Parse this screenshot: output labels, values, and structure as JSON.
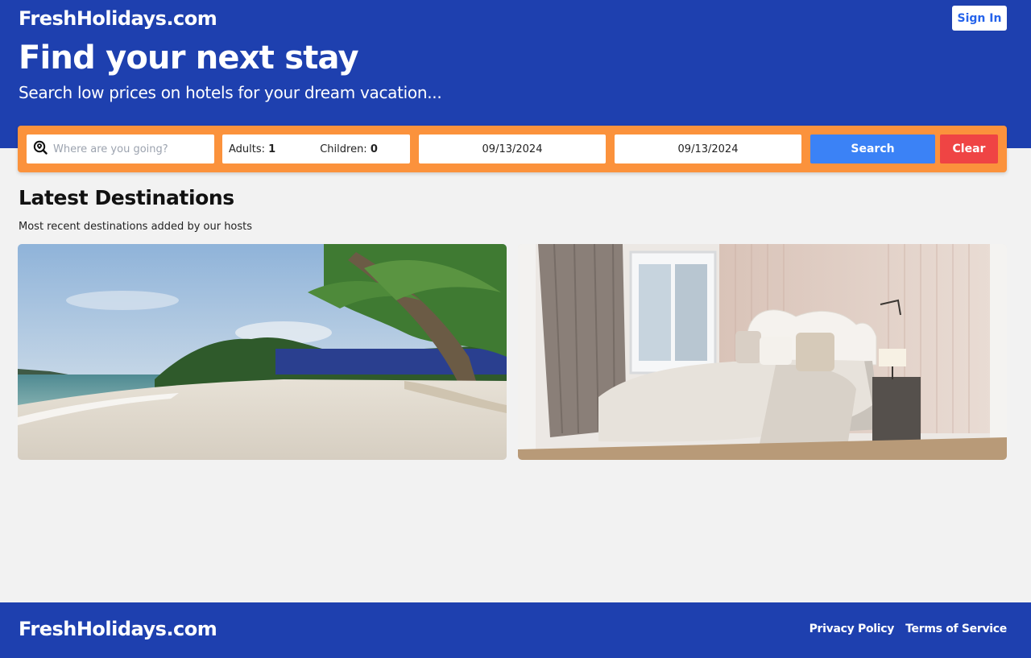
{
  "header": {
    "logo": "FreshHolidays.com",
    "sign_in_label": "Sign In"
  },
  "hero": {
    "title": "Find your next stay",
    "subtitle": "Search low prices on hotels for your dream vacation..."
  },
  "search": {
    "destination_placeholder": "Where are you going?",
    "destination_icon": "search-location-icon",
    "adults_label": "Adults:",
    "adults_value": "1",
    "children_label": "Children:",
    "children_value": "0",
    "check_in": "09/13/2024",
    "check_out": "09/13/2024",
    "search_label": "Search",
    "clear_label": "Clear"
  },
  "latest": {
    "title": "Latest Destinations",
    "subtitle": "Most recent destinations added by our hosts",
    "cards": [
      {
        "image": "beach-photo"
      },
      {
        "image": "hotel-bedroom-photo"
      }
    ]
  },
  "footer": {
    "logo": "FreshHolidays.com",
    "links": [
      "Privacy Policy",
      "Terms of Service"
    ]
  },
  "colors": {
    "brand_blue": "#1e40af",
    "search_orange": "#fb923c",
    "search_button": "#3b82f6",
    "clear_button": "#ef4444"
  }
}
